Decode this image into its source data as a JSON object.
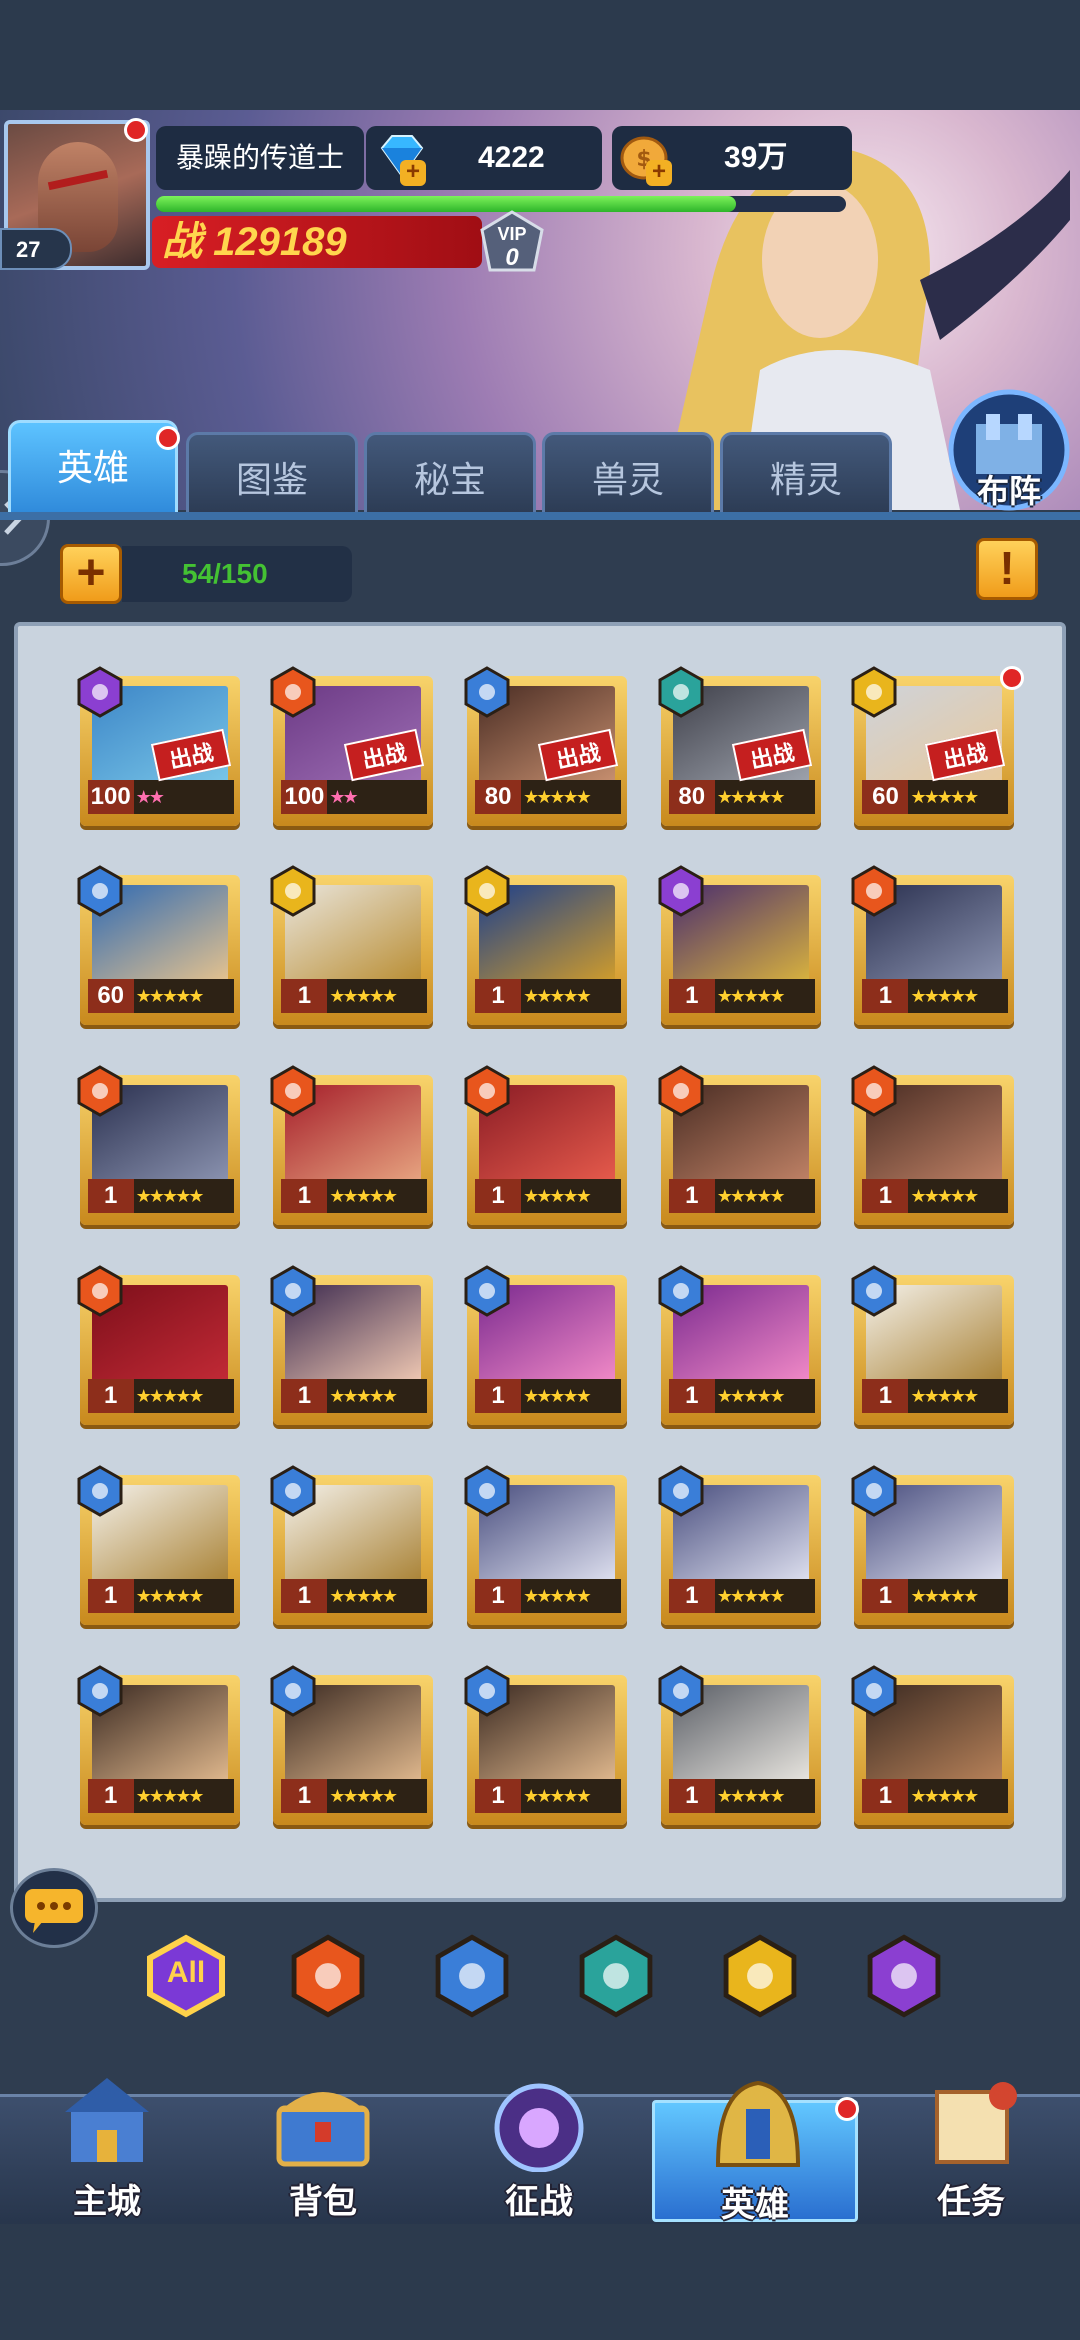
{
  "player": {
    "name": "暴躁的传道士",
    "level": "27",
    "gems": "4222",
    "gold": "39万",
    "power_prefix": "战",
    "power": "129189",
    "vip_label": "VIP",
    "vip_level": "0",
    "exp_fraction": 0.84
  },
  "tabs": [
    {
      "label": "英雄",
      "active": true,
      "red_dot": true
    },
    {
      "label": "图鉴"
    },
    {
      "label": "秘宝"
    },
    {
      "label": "兽灵"
    },
    {
      "label": "精灵"
    }
  ],
  "formation_label": "布阵",
  "hero_count": "54/150",
  "plus_symbol": "+",
  "warn_symbol": "!",
  "deployed_tag": "出战",
  "faction_colors": {
    "fire": "#e8561d",
    "ice": "#3a7ed8",
    "undead": "#2aa39b",
    "light": "#e9b51c",
    "dark": "#8b3fd1"
  },
  "heroes": [
    {
      "level": "100",
      "faction": "dark",
      "stars": "★★",
      "star_color": "pink",
      "deployed": true,
      "portrait": [
        "#3d86c7",
        "#79c6e8"
      ]
    },
    {
      "level": "100",
      "faction": "fire",
      "stars": "★★",
      "star_color": "pink",
      "deployed": true,
      "portrait": [
        "#6c3a85",
        "#9e6fb5"
      ]
    },
    {
      "level": "80",
      "faction": "ice",
      "stars": "★★★★★",
      "deployed": true,
      "portrait": [
        "#4a2d24",
        "#c89070"
      ]
    },
    {
      "level": "80",
      "faction": "undead",
      "stars": "★★★★★",
      "deployed": true,
      "portrait": [
        "#40414b",
        "#9ea3ad"
      ]
    },
    {
      "level": "60",
      "faction": "light",
      "stars": "★★★★★",
      "deployed": true,
      "red_dot": true,
      "portrait": [
        "#cfd3da",
        "#e8c99c"
      ]
    },
    {
      "level": "60",
      "faction": "ice",
      "stars": "★★★★★",
      "portrait": [
        "#2f6ab3",
        "#e6c38e"
      ]
    },
    {
      "level": "1",
      "faction": "light",
      "stars": "★★★★★",
      "portrait": [
        "#e9e5dc",
        "#b98d32"
      ]
    },
    {
      "level": "1",
      "faction": "light",
      "stars": "★★★★★",
      "portrait": [
        "#1c3f8c",
        "#d19d2b"
      ]
    },
    {
      "level": "1",
      "faction": "dark",
      "stars": "★★★★★",
      "portrait": [
        "#4a2d6e",
        "#d9b33e"
      ]
    },
    {
      "level": "1",
      "faction": "fire",
      "stars": "★★★★★",
      "portrait": [
        "#2b3150",
        "#8b93b0"
      ]
    },
    {
      "level": "1",
      "faction": "fire",
      "stars": "★★★★★",
      "portrait": [
        "#2b3150",
        "#8b93b0"
      ]
    },
    {
      "level": "1",
      "faction": "fire",
      "stars": "★★★★★",
      "portrait": [
        "#a51e2a",
        "#e7a581"
      ]
    },
    {
      "level": "1",
      "faction": "fire",
      "stars": "★★★★★",
      "portrait": [
        "#8a1c25",
        "#e65b4c"
      ]
    },
    {
      "level": "1",
      "faction": "fire",
      "stars": "★★★★★",
      "portrait": [
        "#4a2d24",
        "#c08266"
      ]
    },
    {
      "level": "1",
      "faction": "fire",
      "stars": "★★★★★",
      "portrait": [
        "#4a2d24",
        "#c08266"
      ]
    },
    {
      "level": "1",
      "faction": "fire",
      "stars": "★★★★★",
      "portrait": [
        "#7d0f1a",
        "#c22a36"
      ]
    },
    {
      "level": "1",
      "faction": "ice",
      "stars": "★★★★★",
      "portrait": [
        "#3c2a4f",
        "#f0c9b3"
      ]
    },
    {
      "level": "1",
      "faction": "ice",
      "stars": "★★★★★",
      "portrait": [
        "#7a2a8f",
        "#f28ac7"
      ]
    },
    {
      "level": "1",
      "faction": "ice",
      "stars": "★★★★★",
      "portrait": [
        "#7a2a8f",
        "#f28ac7"
      ]
    },
    {
      "level": "1",
      "faction": "ice",
      "stars": "★★★★★",
      "portrait": [
        "#f4f1ea",
        "#a98235"
      ]
    },
    {
      "level": "1",
      "faction": "ice",
      "stars": "★★★★★",
      "portrait": [
        "#f4f1ea",
        "#a98235"
      ]
    },
    {
      "level": "1",
      "faction": "ice",
      "stars": "★★★★★",
      "portrait": [
        "#f4f1ea",
        "#a98235"
      ]
    },
    {
      "level": "1",
      "faction": "ice",
      "stars": "★★★★★",
      "portrait": [
        "#4a4f7f",
        "#dfe1f0"
      ]
    },
    {
      "level": "1",
      "faction": "ice",
      "stars": "★★★★★",
      "portrait": [
        "#4a4f7f",
        "#dfe1f0"
      ]
    },
    {
      "level": "1",
      "faction": "ice",
      "stars": "★★★★★",
      "portrait": [
        "#4a4f7f",
        "#dfe1f0"
      ]
    },
    {
      "level": "1",
      "faction": "ice",
      "stars": "★★★★★",
      "portrait": [
        "#3b2a22",
        "#e1b98e"
      ]
    },
    {
      "level": "1",
      "faction": "ice",
      "stars": "★★★★★",
      "portrait": [
        "#3b2a22",
        "#e1b98e"
      ]
    },
    {
      "level": "1",
      "faction": "ice",
      "stars": "★★★★★",
      "portrait": [
        "#3b2a22",
        "#e1b98e"
      ]
    },
    {
      "level": "1",
      "faction": "ice",
      "stars": "★★★★★",
      "portrait": [
        "#5a5e66",
        "#e9e6e0"
      ]
    },
    {
      "level": "1",
      "faction": "ice",
      "stars": "★★★★★",
      "portrait": [
        "#3b2a22",
        "#b9835a"
      ]
    }
  ],
  "filters": [
    {
      "name": "all",
      "label": "All"
    },
    {
      "name": "fire"
    },
    {
      "name": "ice"
    },
    {
      "name": "undead"
    },
    {
      "name": "light"
    },
    {
      "name": "dark"
    }
  ],
  "nav": [
    {
      "label": "主城",
      "icon": "castle-icon"
    },
    {
      "label": "背包",
      "icon": "chest-icon"
    },
    {
      "label": "征战",
      "icon": "portal-icon"
    },
    {
      "label": "英雄",
      "icon": "helmet-icon",
      "active": true,
      "red_dot": true
    },
    {
      "label": "任务",
      "icon": "scroll-icon"
    }
  ]
}
